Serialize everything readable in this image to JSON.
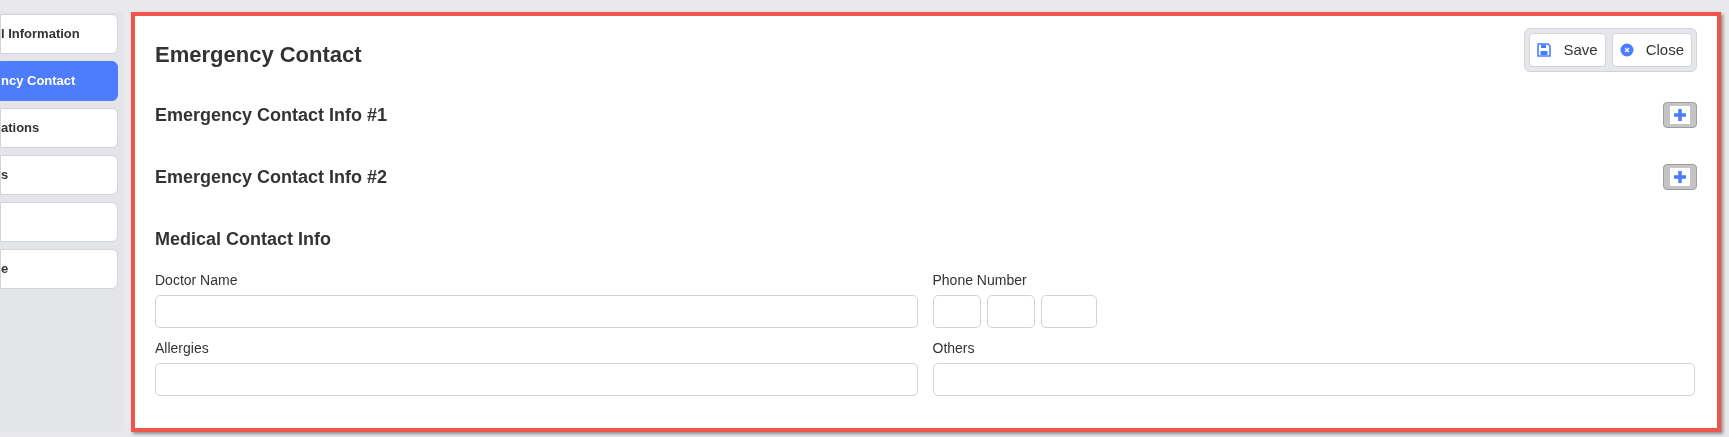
{
  "sidebar": {
    "items": [
      {
        "label": "l Information",
        "selected": false
      },
      {
        "label": "ncy Contact",
        "selected": true
      },
      {
        "label": "ations",
        "selected": false
      },
      {
        "label": "s",
        "selected": false
      },
      {
        "selected": false
      },
      {
        "label": "e",
        "selected": false
      }
    ]
  },
  "form": {
    "title": "Emergency Contact",
    "buttons": [
      {
        "kind": "save",
        "label": "Save"
      },
      {
        "kind": "close",
        "label": "Close"
      }
    ],
    "sections": [
      {
        "title": "Emergency Contact Info #1",
        "collapsed": true
      },
      {
        "title": "Emergency Contact Info #2",
        "collapsed": true
      },
      {
        "title": "Medical Contact Info",
        "collapsed": false
      }
    ],
    "fields": [
      {
        "kind": "text",
        "label": "Doctor Name"
      },
      {
        "kind": "phone",
        "label": "Phone Number"
      },
      {
        "kind": "text",
        "label": "Allergies"
      },
      {
        "kind": "text",
        "label": "Others"
      }
    ]
  }
}
